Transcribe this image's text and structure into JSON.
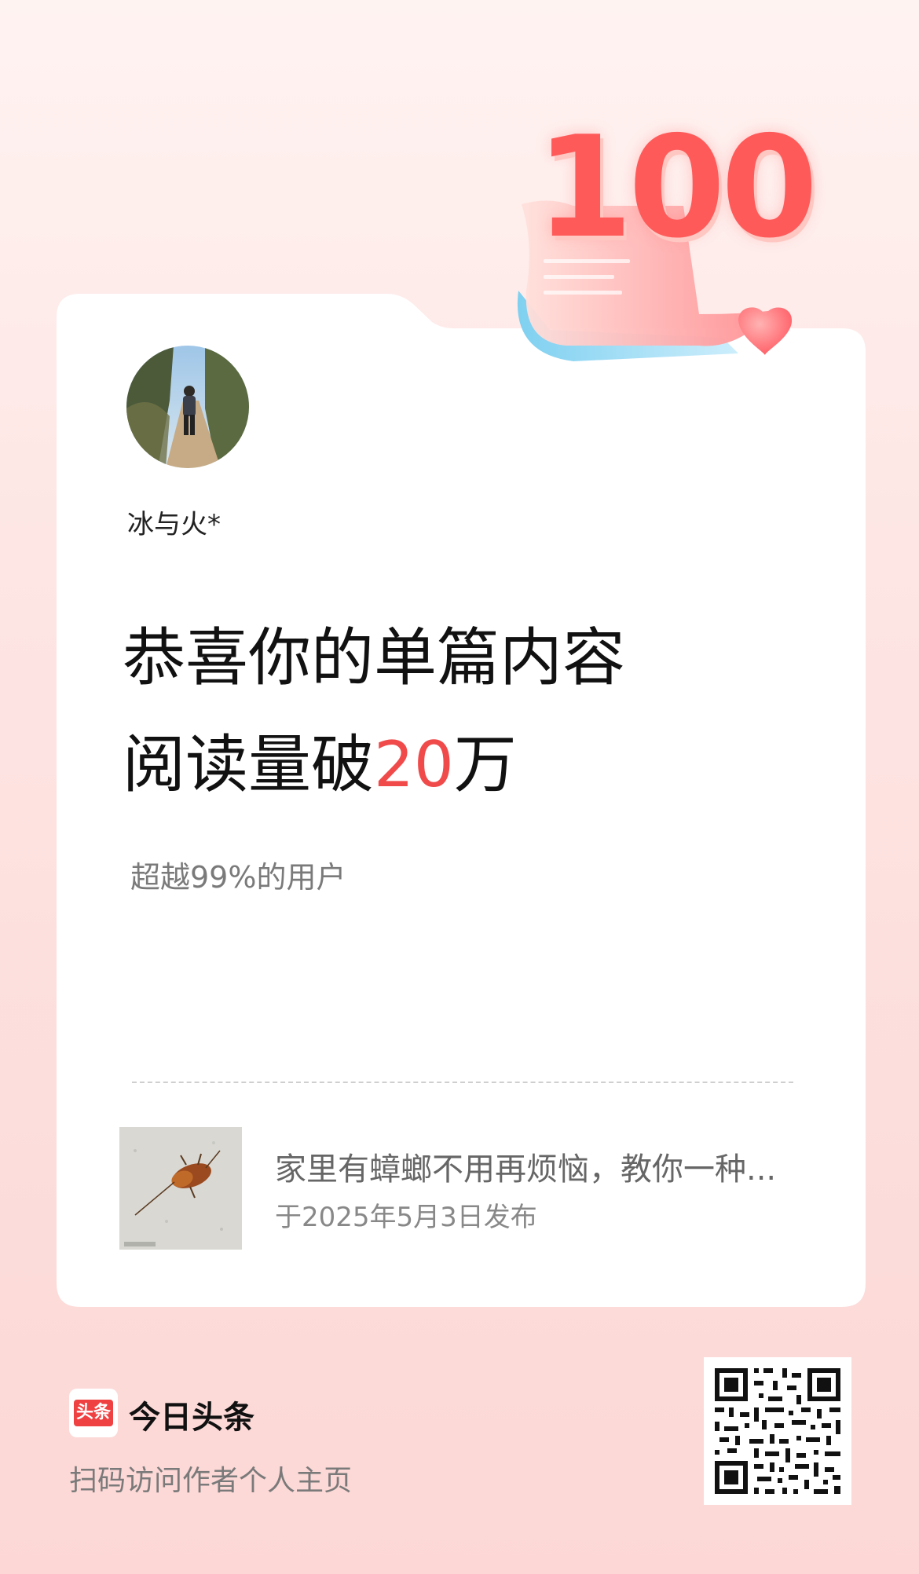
{
  "author": {
    "name": "冰与火*"
  },
  "badge": {
    "number": "100"
  },
  "headline": {
    "line1": "恭喜你的单篇内容",
    "line2_prefix": "阅读量破",
    "line2_number": "20",
    "line2_suffix": "万"
  },
  "subtext": "超越99%的用户",
  "article": {
    "title": "家里有蟑螂不用再烦恼，教你一种...",
    "date": "于2025年5月3日发布"
  },
  "footer": {
    "logo_text": "头条",
    "brand": "今日头条",
    "caption": "扫码访问作者个人主页"
  },
  "colors": {
    "accent": "#f04a4a",
    "brand_red": "#f04142",
    "background_top": "#fff3f1",
    "background_bottom": "#fcd7d5",
    "card": "#ffffff"
  }
}
